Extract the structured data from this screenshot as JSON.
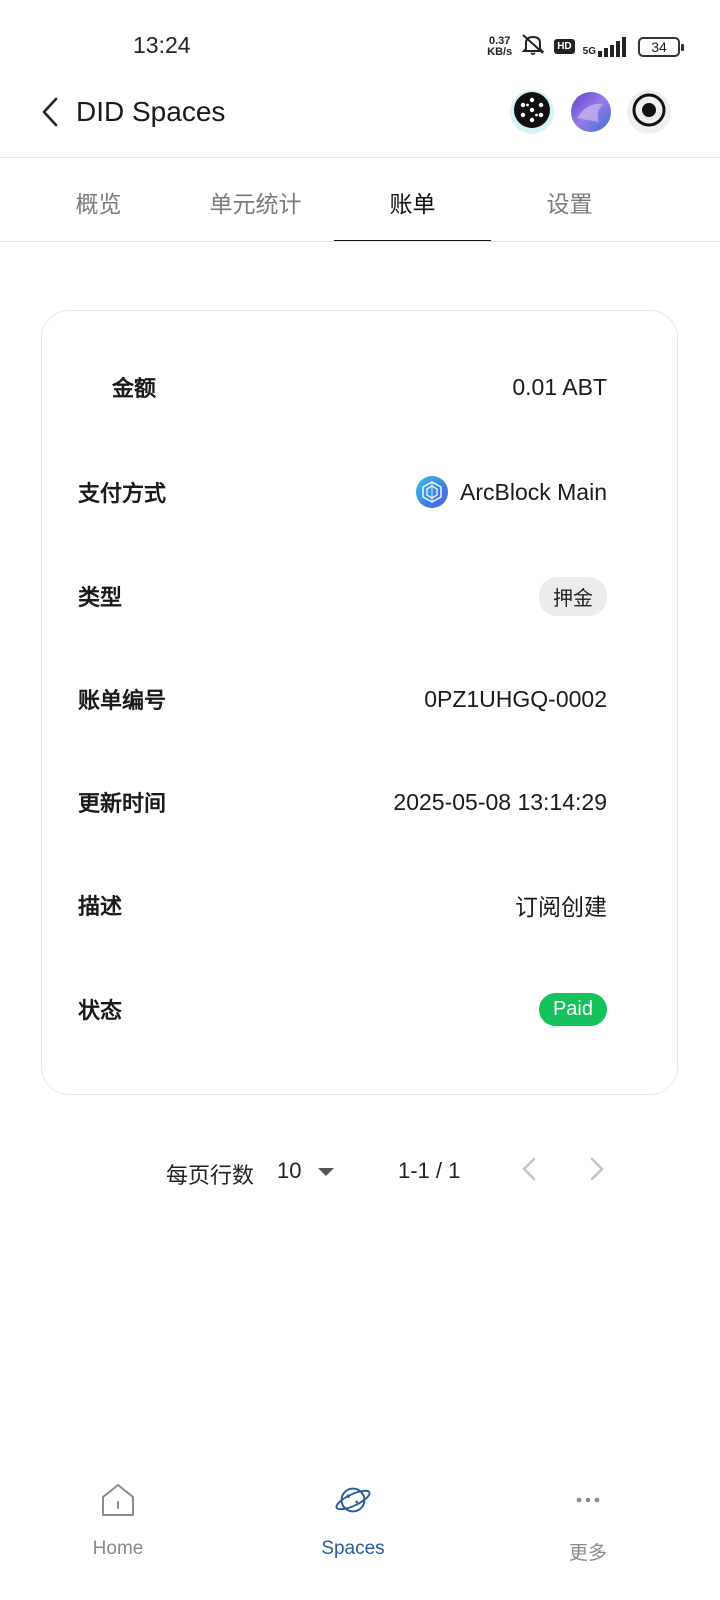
{
  "status_bar": {
    "time": "13:24",
    "net_speed_value": "0.37",
    "net_speed_unit": "KB/s",
    "hd_label": "HD",
    "network_label": "5G",
    "battery": "34"
  },
  "header": {
    "title": "DID Spaces",
    "icons": [
      "back-icon",
      "app-grid-icon",
      "avatar-icon",
      "record-icon"
    ]
  },
  "tabs": [
    {
      "label": "概览",
      "active": false
    },
    {
      "label": "单元统计",
      "active": false
    },
    {
      "label": "账单",
      "active": true
    },
    {
      "label": "设置",
      "active": false
    }
  ],
  "bill": {
    "amount_label": "金额",
    "amount_value": "0.01 ABT",
    "payment_label": "支付方式",
    "payment_value": "ArcBlock Main",
    "type_label": "类型",
    "type_value": "押金",
    "number_label": "账单编号",
    "number_value": "0PZ1UHGQ-0002",
    "updated_label": "更新时间",
    "updated_value": "2025-05-08 13:14:29",
    "desc_label": "描述",
    "desc_value": "订阅创建",
    "status_label": "状态",
    "status_value": "Paid",
    "status_color": "#16c25c"
  },
  "pagination": {
    "rows_per_page_label": "每页行数",
    "rows_per_page_value": "10",
    "range": "1-1 / 1"
  },
  "bottom_nav": [
    {
      "label": "Home",
      "icon": "home-icon",
      "active": false
    },
    {
      "label": "Spaces",
      "icon": "planet-icon",
      "active": true
    },
    {
      "label": "更多",
      "icon": "more-icon",
      "active": false
    }
  ],
  "colors": {
    "accent": "#2a5b9a",
    "active_tab": "#111111",
    "paid": "#16c25c"
  }
}
